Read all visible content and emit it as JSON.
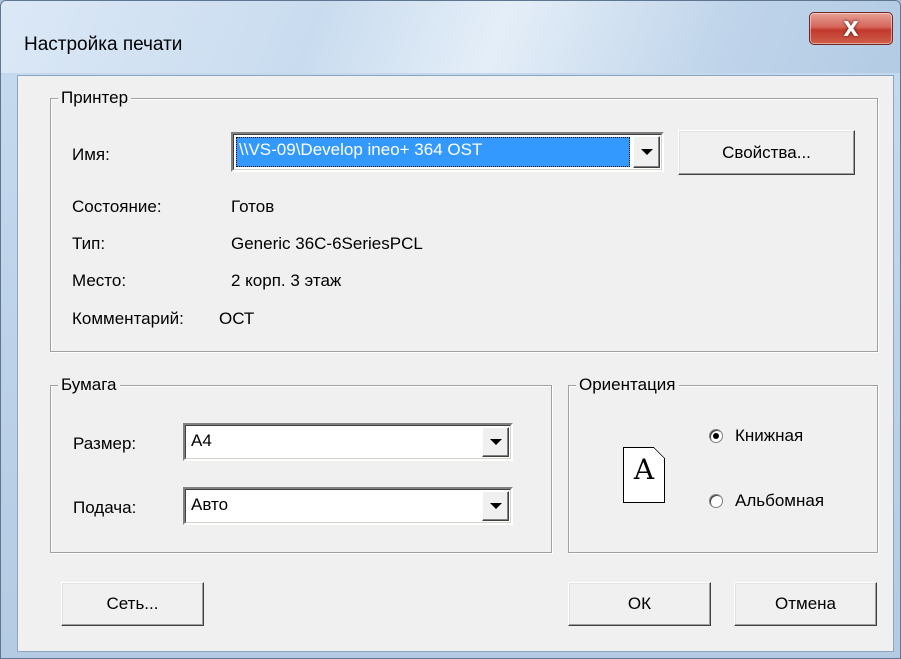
{
  "window": {
    "title": "Настройка печати",
    "close_glyph": "X"
  },
  "printer": {
    "group_label": "Принтер",
    "name_label": "Имя:",
    "name_value": "\\\\VS-09\\Develop ineo+ 364 OST",
    "properties_button": "Свойства...",
    "status_label": "Состояние:",
    "status_value": "Готов",
    "type_label": "Тип:",
    "type_value": "Generic 36C-6SeriesPCL",
    "location_label": "Место:",
    "location_value": "2 корп. 3 этаж",
    "comment_label": "Комментарий:",
    "comment_value": "ОСТ"
  },
  "paper": {
    "group_label": "Бумага",
    "size_label": "Размер:",
    "size_value": "A4",
    "source_label": "Подача:",
    "source_value": "Авто"
  },
  "orientation": {
    "group_label": "Ориентация",
    "icon_letter": "A",
    "portrait_label": "Книжная",
    "landscape_label": "Альбомная",
    "selected": "portrait"
  },
  "buttons": {
    "network": "Сеть...",
    "ok": "ОК",
    "cancel": "Отмена"
  },
  "colors": {
    "selection": "#3399ff",
    "close_button": "#c1392c",
    "dialog_face": "#f0f0f0"
  },
  "icons": {
    "close": "close-icon",
    "dropdown": "chevron-down-icon",
    "orientation": "page-portrait-icon"
  }
}
